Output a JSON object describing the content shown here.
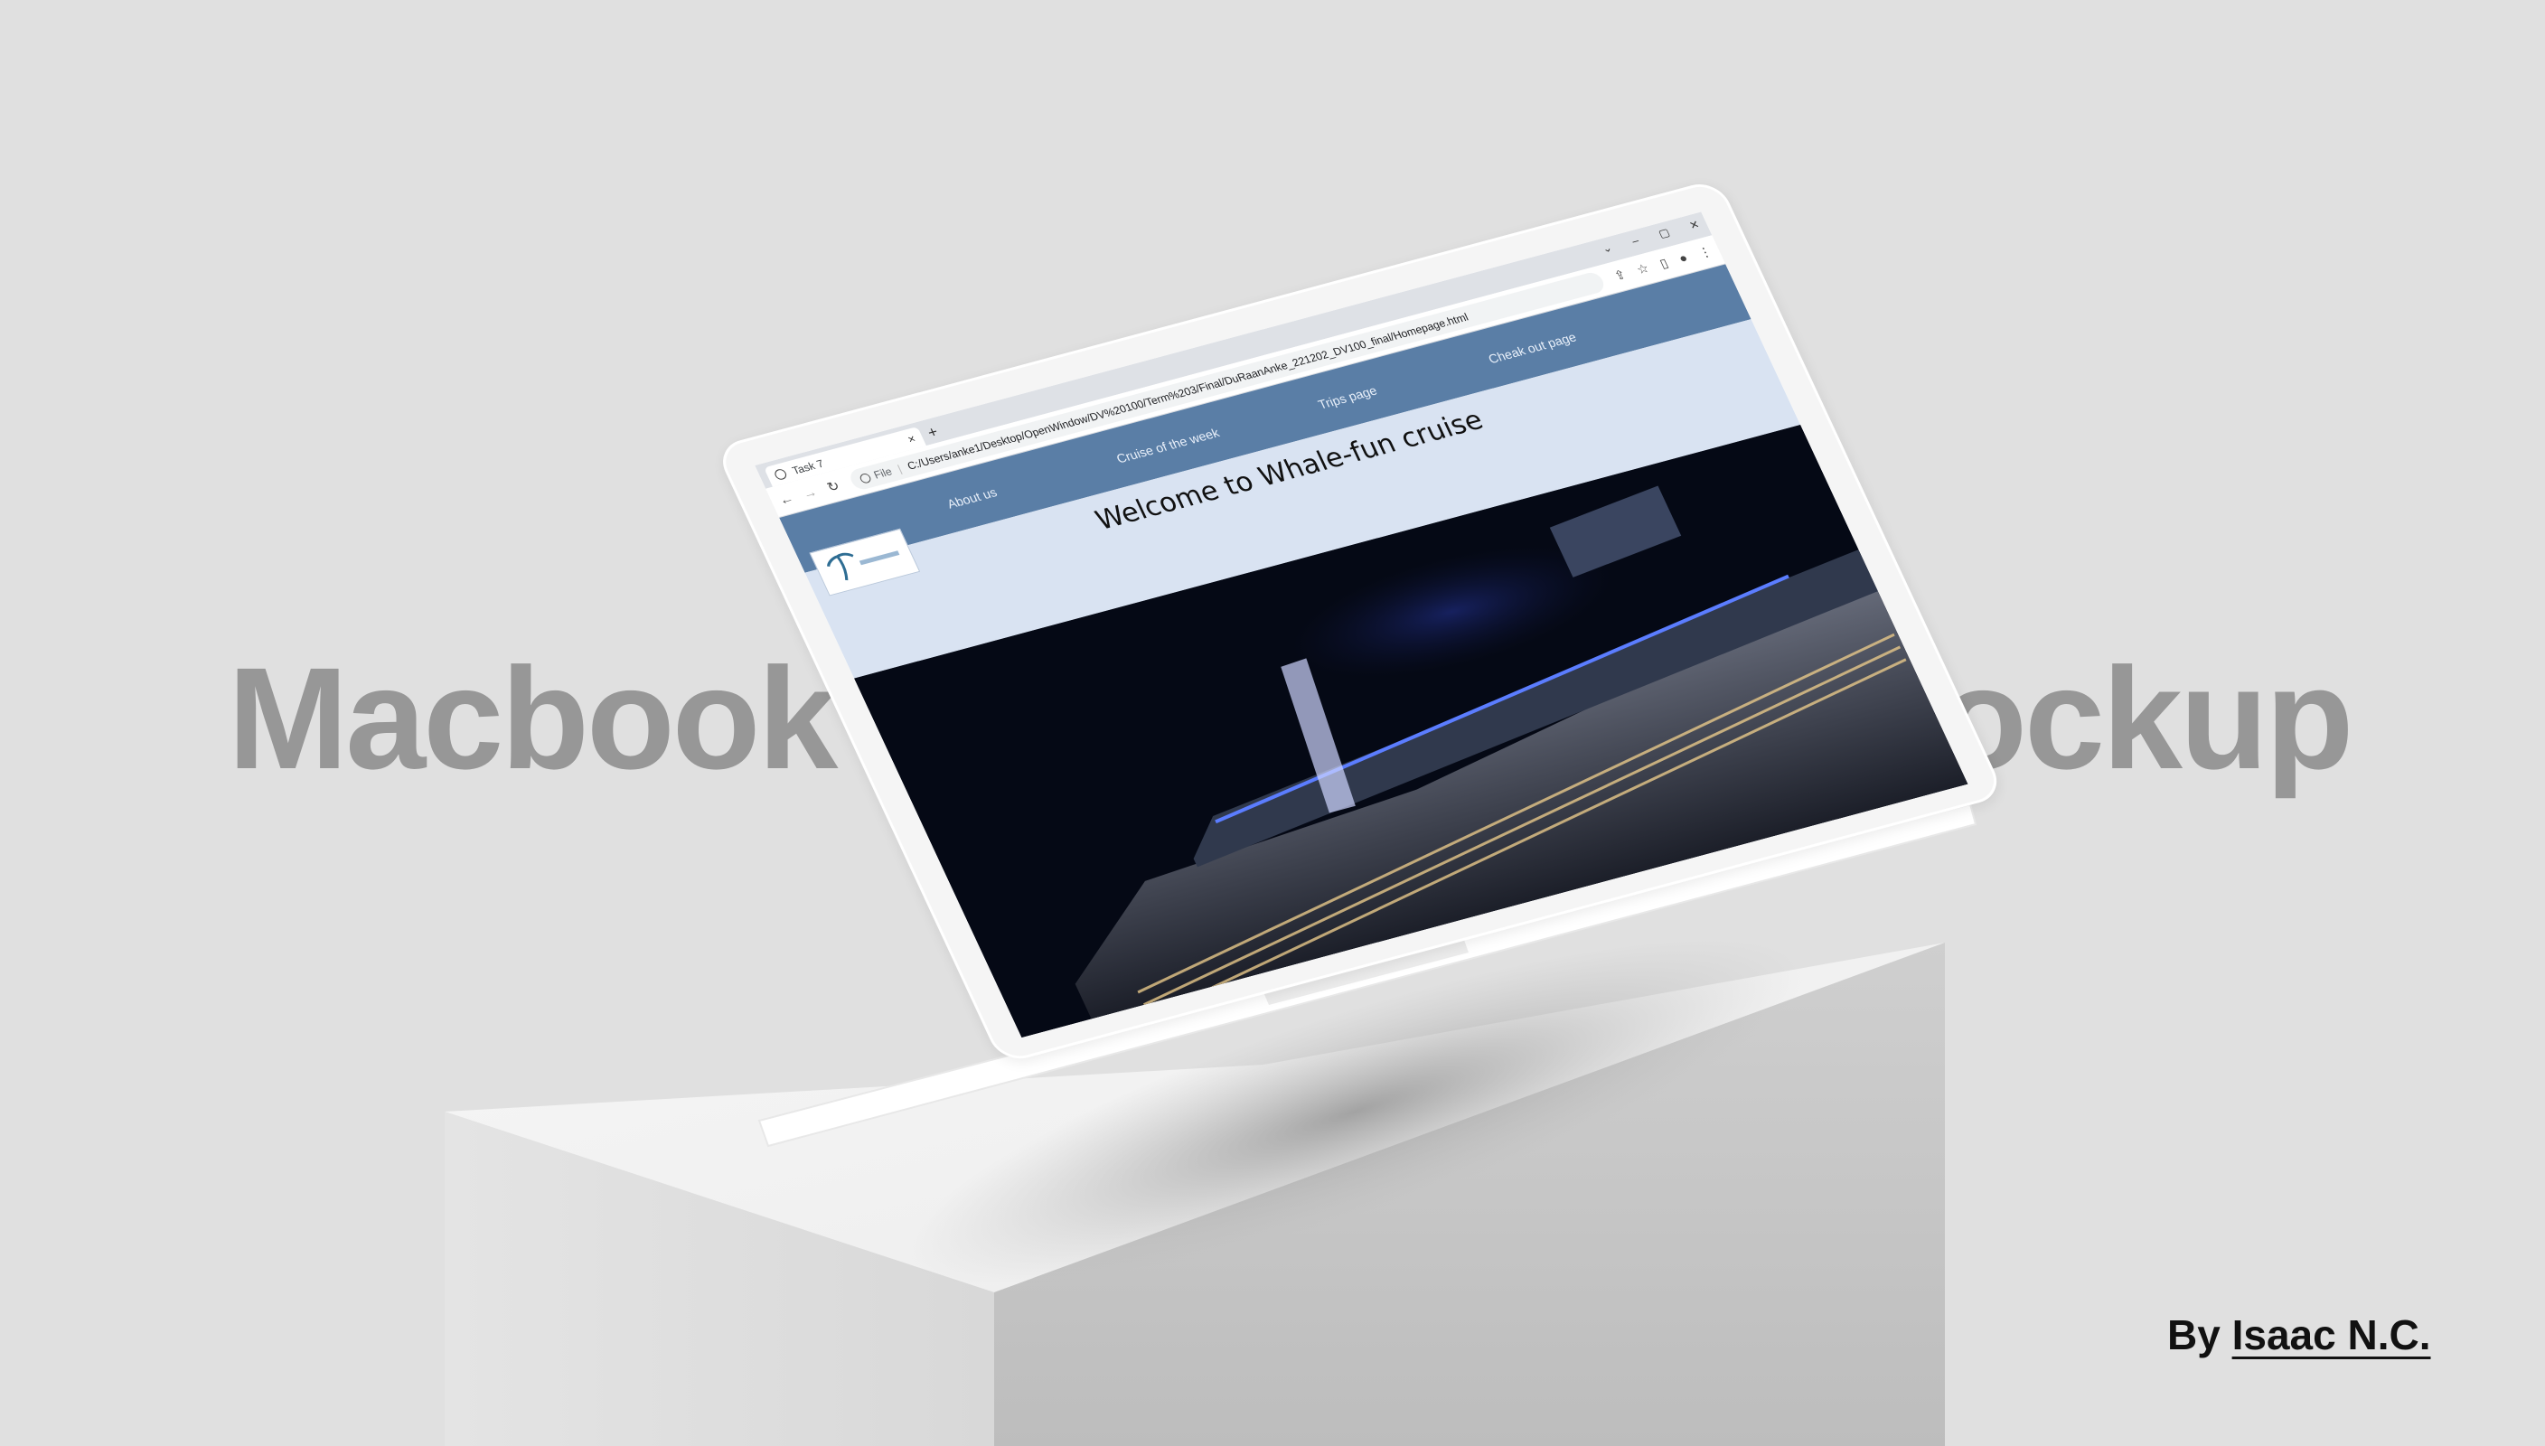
{
  "background": {
    "left_word": "Macbook",
    "right_word": "Mockup",
    "color": "#e0e0e0",
    "word_color": "#979797"
  },
  "byline": {
    "prefix": "By",
    "name": "Isaac N.C."
  },
  "browser": {
    "tab_title": "Task 7",
    "tab_close": "×",
    "new_tab": "+",
    "window_controls": [
      "⌄",
      "–",
      "▢",
      "✕"
    ],
    "back": "←",
    "forward": "→",
    "reload": "↻",
    "scheme": "File",
    "url": "C:/Users/anke1/Desktop/OpenWindow/DV%20100/Term%203/Final/DuRaanAnke_221202_DV100_final/Homepage.html",
    "toolbar_icons": [
      "share-icon",
      "star-icon",
      "sidebar-icon",
      "profile-icon",
      "menu-icon"
    ]
  },
  "website": {
    "nav": {
      "about": "About us",
      "cruise_week": "Cruise of the week",
      "trips": "Trips page",
      "checkout": "Cheak out page"
    },
    "title": "Welcome to Whale-fun cruise",
    "nav_color": "#5a7ea6",
    "header_color": "#d9e3f2",
    "hero_color": "#050915"
  }
}
